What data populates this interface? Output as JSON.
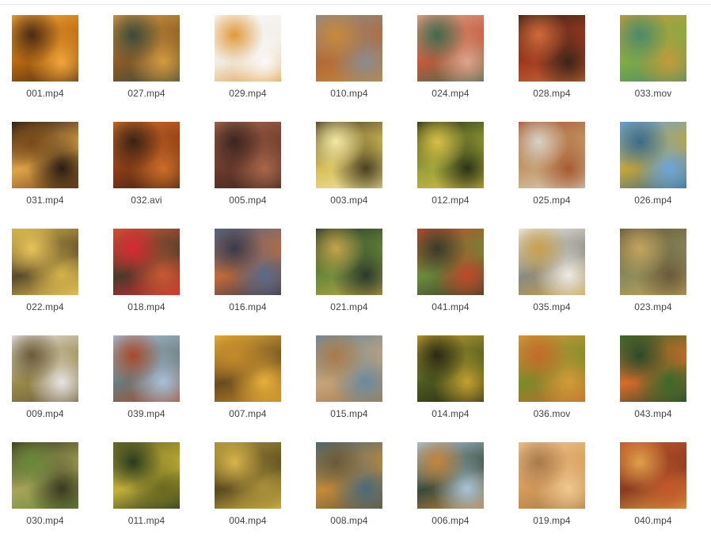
{
  "files": [
    {
      "name": "001.mp4",
      "colors": [
        "#f3a63a",
        "#b5670f",
        "#4a2a12"
      ]
    },
    {
      "name": "027.mp4",
      "colors": [
        "#d49a3f",
        "#8a5a28",
        "#3b4a3a"
      ]
    },
    {
      "name": "029.mp4",
      "colors": [
        "#fafafa",
        "#f1ece6",
        "#e09a3c"
      ]
    },
    {
      "name": "010.mp4",
      "colors": [
        "#8a8c8e",
        "#b36a38",
        "#c88a3c"
      ]
    },
    {
      "name": "024.mp4",
      "colors": [
        "#e0a38c",
        "#c05a3a",
        "#3f6a4c"
      ]
    },
    {
      "name": "028.mp4",
      "colors": [
        "#3a2418",
        "#a13a20",
        "#d06a3a"
      ]
    },
    {
      "name": "033.mov",
      "colors": [
        "#c49b3a",
        "#7faa45",
        "#4a8a6a"
      ]
    },
    {
      "name": "031.mp4",
      "colors": [
        "#2a1c12",
        "#e0a448",
        "#7a4a1a"
      ]
    },
    {
      "name": "032.avi",
      "colors": [
        "#cd6e2a",
        "#8c3c16",
        "#3a2214"
      ]
    },
    {
      "name": "005.mp4",
      "colors": [
        "#a8664a",
        "#6a3a2c",
        "#3c2420"
      ]
    },
    {
      "name": "003.mp4",
      "colors": [
        "#4a4020",
        "#d8c05c",
        "#f3e8a4"
      ]
    },
    {
      "name": "012.mp4",
      "colors": [
        "#2a3414",
        "#9aa03a",
        "#d8c048"
      ]
    },
    {
      "name": "025.mp4",
      "colors": [
        "#a85a30",
        "#c49a6a",
        "#d8d2c6"
      ]
    },
    {
      "name": "026.mp4",
      "colors": [
        "#6aa6dc",
        "#c2a43a",
        "#3a6a8a"
      ]
    },
    {
      "name": "022.mp4",
      "colors": [
        "#d4b24a",
        "#5a4a2a",
        "#e8c45a"
      ]
    },
    {
      "name": "018.mp4",
      "colors": [
        "#c85a34",
        "#4a3a2a",
        "#d82a34"
      ]
    },
    {
      "name": "016.mp4",
      "colors": [
        "#5a6a8a",
        "#c06a3a",
        "#3a3a4a"
      ]
    },
    {
      "name": "021.mp4",
      "colors": [
        "#2a3a2a",
        "#6a8a3a",
        "#c4a44a"
      ]
    },
    {
      "name": "041.mp4",
      "colors": [
        "#c0482a",
        "#6a8a3a",
        "#3a3a2a"
      ]
    },
    {
      "name": "035.mp4",
      "colors": [
        "#eeeae4",
        "#8a8a80",
        "#c8a04a"
      ]
    },
    {
      "name": "023.mp4",
      "colors": [
        "#6a5a3a",
        "#8a8a5a",
        "#c4a460"
      ]
    },
    {
      "name": "009.mp4",
      "colors": [
        "#e8e4e4",
        "#9a8a4a",
        "#6a5a3a"
      ]
    },
    {
      "name": "039.mp4",
      "colors": [
        "#a8c0d8",
        "#6a7a7a",
        "#a84a2a"
      ]
    },
    {
      "name": "007.mp4",
      "colors": [
        "#e8b03a",
        "#6a4a20",
        "#c48a2a"
      ]
    },
    {
      "name": "015.mp4",
      "colors": [
        "#6a8aa0",
        "#c4a47a",
        "#a87a4a"
      ]
    },
    {
      "name": "014.mp4",
      "colors": [
        "#c4a030",
        "#4a5a20",
        "#2a2a14"
      ]
    },
    {
      "name": "036.mov",
      "colors": [
        "#d49a3a",
        "#7a8a2a",
        "#c46a2a"
      ]
    },
    {
      "name": "043.mp4",
      "colors": [
        "#3a6a2a",
        "#d86a2a",
        "#2a4a2a"
      ]
    },
    {
      "name": "030.mp4",
      "colors": [
        "#3a3a20",
        "#a8a45a",
        "#6a8a3a"
      ]
    },
    {
      "name": "011.mp4",
      "colors": [
        "#6a6a20",
        "#c4b03a",
        "#2a3a20"
      ]
    },
    {
      "name": "004.mp4",
      "colors": [
        "#a8903a",
        "#5a4a20",
        "#d8b44a"
      ]
    },
    {
      "name": "008.mp4",
      "colors": [
        "#4a6a7a",
        "#c48a3a",
        "#6a5a3a"
      ]
    },
    {
      "name": "006.mp4",
      "colors": [
        "#a8c4d8",
        "#3a4a3a",
        "#c4843a"
      ]
    },
    {
      "name": "019.mp4",
      "colors": [
        "#f0c890",
        "#d49a5a",
        "#a87a4a"
      ]
    },
    {
      "name": "040.mp4",
      "colors": [
        "#c4582a",
        "#8a3a20",
        "#e0a04a"
      ]
    }
  ]
}
